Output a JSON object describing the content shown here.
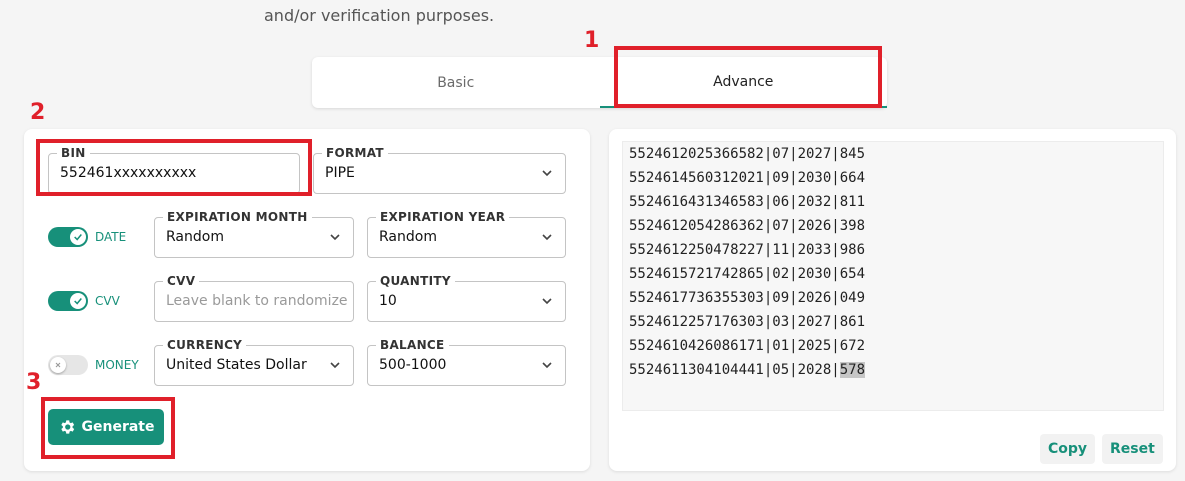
{
  "intro_text": "and/or verification purposes.",
  "tabs": [
    {
      "label": "Basic"
    },
    {
      "label": "Advance"
    }
  ],
  "form": {
    "bin": {
      "label": "BIN",
      "value": "552461xxxxxxxxxx"
    },
    "format": {
      "label": "FORMAT",
      "value": "PIPE"
    },
    "date_toggle": {
      "label": "DATE",
      "state": "on"
    },
    "exp_month": {
      "label": "EXPIRATION MONTH",
      "value": "Random"
    },
    "exp_year": {
      "label": "EXPIRATION YEAR",
      "value": "Random"
    },
    "cvv_toggle": {
      "label": "CVV",
      "state": "on"
    },
    "cvv": {
      "label": "CVV",
      "placeholder": "Leave blank to randomize"
    },
    "quantity": {
      "label": "QUANTITY",
      "value": "10"
    },
    "money_toggle": {
      "label": "MONEY",
      "state": "off"
    },
    "currency": {
      "label": "CURRENCY",
      "value": "United States Dollar"
    },
    "balance": {
      "label": "BALANCE",
      "value": "500-1000"
    },
    "generate_label": "Generate"
  },
  "output": {
    "lines": [
      "5524612025366582|07|2027|845",
      "5524614560312021|09|2030|664",
      "5524616431346583|06|2032|811",
      "5524612054286362|07|2026|398",
      "5524612250478227|11|2033|986",
      "5524615721742865|02|2030|654",
      "5524617736355303|09|2026|049",
      "5524612257176303|03|2027|861",
      "5524610426086171|01|2025|672"
    ],
    "last_line_prefix": "5524611304104441|05|2028|",
    "last_line_selected": "578",
    "copy_label": "Copy",
    "reset_label": "Reset"
  },
  "annotations": [
    "1",
    "2",
    "3"
  ],
  "colors": {
    "accent": "#17907a",
    "annotation": "#e0202a"
  }
}
